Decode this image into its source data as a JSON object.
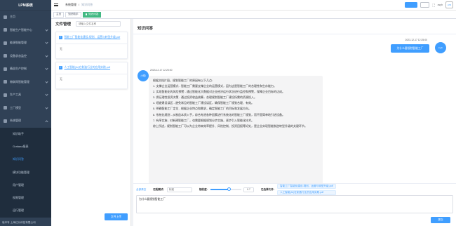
{
  "app": {
    "title": "LPM系统"
  },
  "sidebar": {
    "items": [
      {
        "label": "主页",
        "expandable": false
      },
      {
        "label": "智能生产智能中心",
        "expandable": true
      },
      {
        "label": "能源智能管理",
        "expandable": true
      },
      {
        "label": "设备状态监控",
        "expandable": true
      },
      {
        "label": "精益生产控制",
        "expandable": true
      },
      {
        "label": "物联网智能管理",
        "expandable": true
      },
      {
        "label": "生产工具",
        "expandable": true
      },
      {
        "label": "工厂模型",
        "expandable": true
      },
      {
        "label": "系统管理",
        "expandable": true,
        "open": true
      }
    ],
    "sub_items": [
      {
        "label": "知识助手",
        "active": false
      },
      {
        "label": "Grafana报表",
        "active": false
      },
      {
        "label": "知识问答",
        "active": true
      },
      {
        "label": "模块功能管理",
        "active": false
      },
      {
        "label": "用户管理",
        "active": false
      },
      {
        "label": "权限管理",
        "active": false
      },
      {
        "label": "运行管理",
        "active": false
      }
    ],
    "footer": "版本号 上海亿为科技有限公司"
  },
  "navbar": {
    "breadcrumb": [
      "系统管理",
      "/",
      "知识问答"
    ],
    "btn_primary": "",
    "btn_plain": "",
    "user_name": "zsyh",
    "logo_text": "LPM"
  },
  "tags": [
    {
      "label": "主页",
      "active": false
    },
    {
      "label": "知识助手",
      "active": false
    },
    {
      "label": "知识问答",
      "active": true
    }
  ],
  "files": {
    "title": "文件管理",
    "search_placeholder": "请输入文件名称",
    "items": [
      {
        "name": "智能工厂智能化建设-规划、运营与转型升级.pdf",
        "content": "无"
      },
      {
        "name": "人工智能(AI)在制造行业的应用实践.pdf",
        "content": "无"
      }
    ],
    "upload_label": "文件上传"
  },
  "chat": {
    "title": "知识问答",
    "user": {
      "time": "2023-12-17 12:25:00",
      "text": "为什么要规划智能工厂",
      "avatar": "zsyh"
    },
    "bot": {
      "time": "2023-12-17 12:25:00",
      "avatar": "小助",
      "paragraphs": [
        "根据文档片段，规划智能工厂的原因有以下几点:",
        "1. 支撑企业运营模式 - 智能工厂需要支撑企业的运营模式，因为这是智能工厂的合理性和生存能力。",
        "2. 实现智能化的风险预警 - 通过智能化大数据对企业经济运行状况进行监控和预警，保障企业目标的达成。",
        "3. 保证理性投资决策 - 通过投资收益核算，合理规划智能工厂建设所需的资源投入。",
        "4. 规避建设误区 - 避免常见的智能工厂建设误区，确保智能工厂规划合理、有效。",
        "5. 明确智能工厂定位 - 根据企业特点和需求，确定智能工厂的目标和发展方向。",
        "6. 系统化规划 - 从制造本质入手，综合考虑各种因素进行系统化的智能工厂规划，而不是简单地引进设备。",
        "7. 有序实施 - 对新建智能工厂，也需要根据规划分步实施，逐步引入智能化技术。",
        "综上所述，规划智能工厂可以为企业带来效率提升、风险控制、投资回报等好处，是企业实现智能制造转型升级的关键环节。"
      ]
    }
  },
  "input_bar": {
    "clear_label": "全部清空",
    "mode_label": "匹配模式:",
    "mode_value": "标准",
    "temp_label": "随机度:",
    "temp_value": "0.7",
    "temp_fraction": 0.6,
    "selected_label": "已选择文件:",
    "selected_files": [
      "智能工厂智能化建设-规划、运营与转型升级.pdf",
      "人工智能(AI)在制造行业的应用实践.pdf"
    ],
    "question_value": "为什么要规划智能工厂",
    "send_label": "提交"
  }
}
